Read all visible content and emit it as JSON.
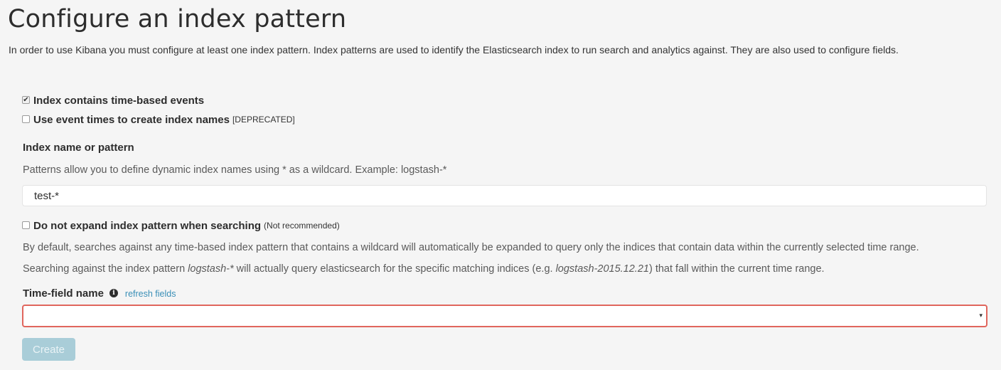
{
  "header": {
    "title": "Configure an index pattern",
    "intro": "In order to use Kibana you must configure at least one index pattern. Index patterns are used to identify the Elasticsearch index to run search and analytics against. They are also used to configure fields."
  },
  "options": {
    "time_based": {
      "label": "Index contains time-based events",
      "checked": true
    },
    "event_times": {
      "label": "Use event times to create index names",
      "note": "[DEPRECATED]",
      "checked": false
    }
  },
  "index_name": {
    "label": "Index name or pattern",
    "help": "Patterns allow you to define dynamic index names using * as a wildcard. Example: logstash-*",
    "value": "test-*"
  },
  "expand": {
    "label": "Do not expand index pattern when searching",
    "note": "(Not recommended)",
    "checked": false,
    "help1": "By default, searches against any time-based index pattern that contains a wildcard will automatically be expanded to query only the indices that contain data within the currently selected time range.",
    "help2_a": "Searching against the index pattern ",
    "help2_em1": "logstash-*",
    "help2_b": " will actually query elasticsearch for the specific matching indices (e.g. ",
    "help2_em2": "logstash-2015.12.21",
    "help2_c": ") that fall within the current time range."
  },
  "time_field": {
    "label": "Time-field name",
    "info_icon": "info-icon",
    "refresh_label": "refresh fields",
    "selected": "",
    "caret": "▾"
  },
  "actions": {
    "create_label": "Create"
  },
  "colors": {
    "error_border": "#e0665d",
    "link": "#3a8fb7",
    "disabled_button": "#a9cdd8"
  }
}
